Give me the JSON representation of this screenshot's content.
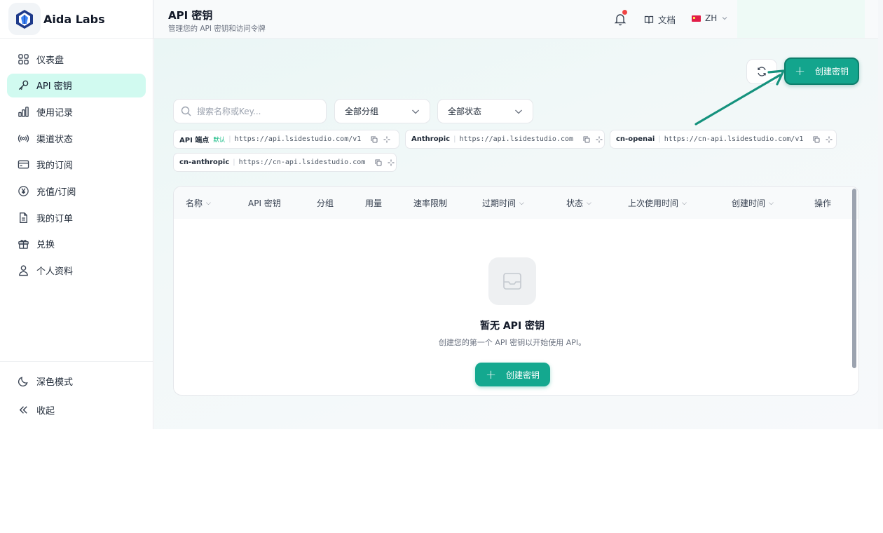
{
  "brand": {
    "name": "Aida Labs"
  },
  "sidebar": {
    "items": [
      {
        "label": "仪表盘",
        "icon": "dashboard-icon"
      },
      {
        "label": "API 密钥",
        "icon": "key-icon",
        "active": true
      },
      {
        "label": "使用记录",
        "icon": "bar-chart-icon"
      },
      {
        "label": "渠道状态",
        "icon": "broadcast-icon"
      },
      {
        "label": "我的订阅",
        "icon": "credit-card-icon"
      },
      {
        "label": "充值/订阅",
        "icon": "yen-coin-icon"
      },
      {
        "label": "我的订单",
        "icon": "document-icon"
      },
      {
        "label": "兑换",
        "icon": "gift-icon"
      },
      {
        "label": "个人资料",
        "icon": "user-icon"
      }
    ],
    "bottom": [
      {
        "label": "深色模式",
        "icon": "moon-icon"
      },
      {
        "label": "收起",
        "icon": "double-chevron-left-icon"
      }
    ]
  },
  "header": {
    "title": "API 密钥",
    "subtitle": "管理您的 API 密钥和访问令牌",
    "docs_label": "文档",
    "lang_label": "ZH",
    "accent_color": "#13a58d"
  },
  "toolbar": {
    "create_label": "创建密钥",
    "search_placeholder": "搜索名称或Key...",
    "group_filter": "全部分组",
    "status_filter": "全部状态"
  },
  "endpoints": [
    {
      "name": "API 端点",
      "badge": "默认",
      "url": "https://api.lsidestudio.com/v1"
    },
    {
      "name": "Anthropic",
      "url": "https://api.lsidestudio.com"
    },
    {
      "name": "cn-openai",
      "url": "https://cn-api.lsidestudio.com/v1"
    },
    {
      "name": "cn-anthropic",
      "url": "https://cn-api.lsidestudio.com"
    }
  ],
  "table": {
    "columns": [
      "名称",
      "API 密钥",
      "分组",
      "用量",
      "速率限制",
      "过期时间",
      "状态",
      "上次使用时间",
      "创建时间",
      "操作"
    ],
    "empty_title": "暂无 API 密钥",
    "empty_desc": "创建您的第一个 API 密钥以开始使用 API。",
    "empty_button": "创建密钥"
  }
}
